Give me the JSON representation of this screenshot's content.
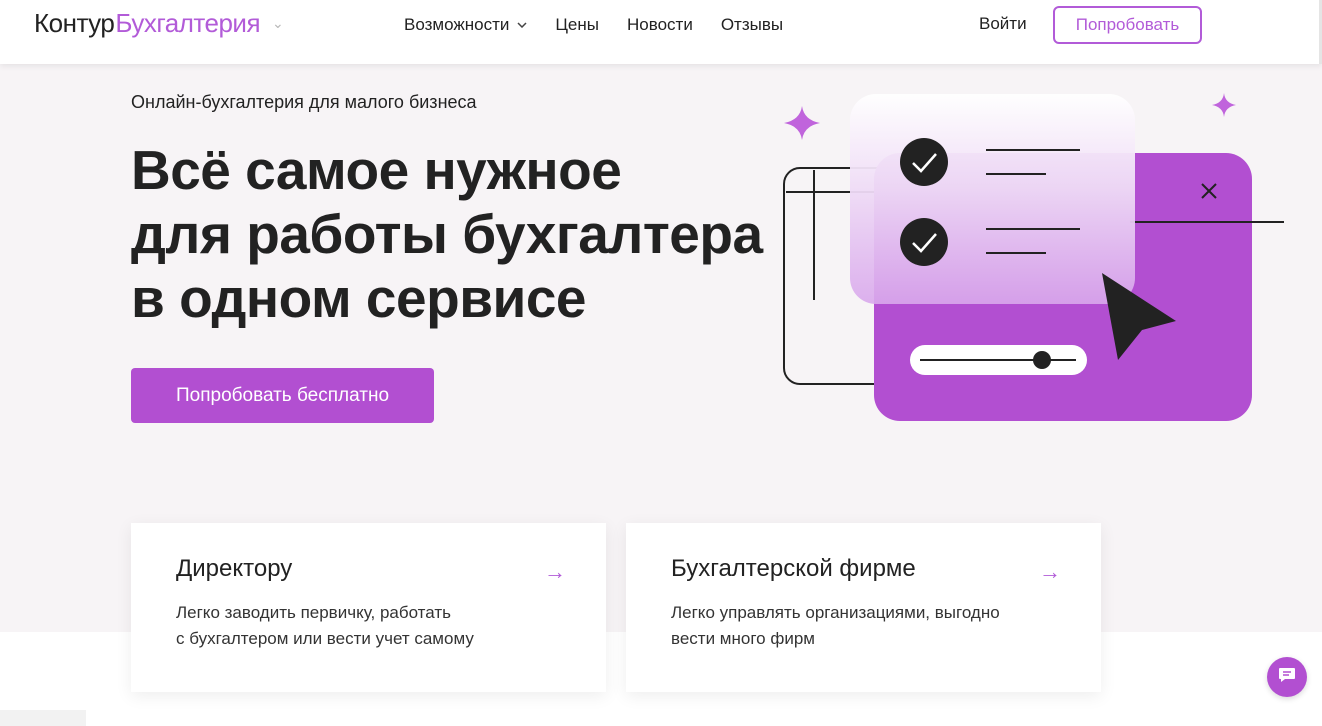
{
  "header": {
    "logo_part1": "Контур",
    "logo_part2": "Бухгалтерия",
    "logo_chevron": "⌄",
    "nav": [
      {
        "label": "Возможности",
        "has_dropdown": true
      },
      {
        "label": "Цены"
      },
      {
        "label": "Новости"
      },
      {
        "label": "Отзывы"
      }
    ],
    "login": "Войти",
    "try": "Попробовать"
  },
  "hero": {
    "subtitle": "Онлайн-бухгалтерия для малого бизнеса",
    "title_lines": [
      "Всё самое нужное",
      "для работы бухгалтера",
      "в одном сервисе"
    ],
    "cta": "Попробовать бесплатно"
  },
  "cards": [
    {
      "title": "Директору",
      "arrow": "→",
      "desc_line1": "Легко заводить первичку, работать",
      "desc_line2": "с бухгалтером или вести учет самому"
    },
    {
      "title": "Бухгалтерской фирме",
      "arrow": "→",
      "desc_line1": "Легко управлять организациями, выгодно",
      "desc_line2": "вести много фирм"
    }
  ],
  "icons": {
    "chat": "chat-icon",
    "check": "check-icon",
    "close": "close-icon",
    "cursor": "cursor-icon",
    "sparkle": "sparkle-icon"
  },
  "colors": {
    "accent": "#b24fd1",
    "logo_accent": "#b25bd8",
    "hero_bg": "#f7f4f6"
  }
}
